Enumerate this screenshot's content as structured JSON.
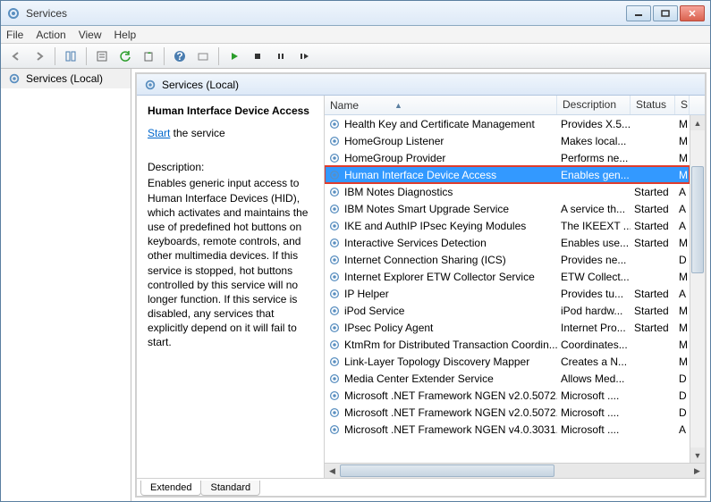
{
  "window": {
    "title": "Services"
  },
  "menu": {
    "file": "File",
    "action": "Action",
    "view": "View",
    "help": "Help"
  },
  "tree": {
    "root": "Services (Local)"
  },
  "header": {
    "label": "Services (Local)"
  },
  "detail": {
    "title": "Human Interface Device Access",
    "start_link": "Start",
    "start_suffix": " the service",
    "desc_heading": "Description:",
    "description": "Enables generic input access to Human Interface Devices (HID), which activates and maintains the use of predefined hot buttons on keyboards, remote controls, and other multimedia devices. If this service is stopped, hot buttons controlled by this service will no longer function. If this service is disabled, any services that explicitly depend on it will fail to start."
  },
  "columns": {
    "name": "Name",
    "description": "Description",
    "status": "Status",
    "startup": "S"
  },
  "services": [
    {
      "name": "Health Key and Certificate Management",
      "desc": "Provides X.5...",
      "status": "",
      "start": "M"
    },
    {
      "name": "HomeGroup Listener",
      "desc": "Makes local...",
      "status": "",
      "start": "M"
    },
    {
      "name": "HomeGroup Provider",
      "desc": "Performs ne...",
      "status": "",
      "start": "M"
    },
    {
      "name": "Human Interface Device Access",
      "desc": "Enables gen...",
      "status": "",
      "start": "M",
      "selected": true,
      "highlighted": true
    },
    {
      "name": "IBM Notes Diagnostics",
      "desc": "",
      "status": "Started",
      "start": "A"
    },
    {
      "name": "IBM Notes Smart Upgrade Service",
      "desc": "A service th...",
      "status": "Started",
      "start": "A"
    },
    {
      "name": "IKE and AuthIP IPsec Keying Modules",
      "desc": "The IKEEXT ...",
      "status": "Started",
      "start": "A"
    },
    {
      "name": "Interactive Services Detection",
      "desc": "Enables use...",
      "status": "Started",
      "start": "M"
    },
    {
      "name": "Internet Connection Sharing (ICS)",
      "desc": "Provides ne...",
      "status": "",
      "start": "D"
    },
    {
      "name": "Internet Explorer ETW Collector Service",
      "desc": "ETW Collect...",
      "status": "",
      "start": "M"
    },
    {
      "name": "IP Helper",
      "desc": "Provides tu...",
      "status": "Started",
      "start": "A"
    },
    {
      "name": "iPod Service",
      "desc": "iPod hardw...",
      "status": "Started",
      "start": "M"
    },
    {
      "name": "IPsec Policy Agent",
      "desc": "Internet Pro...",
      "status": "Started",
      "start": "M"
    },
    {
      "name": "KtmRm for Distributed Transaction Coordin...",
      "desc": "Coordinates...",
      "status": "",
      "start": "M"
    },
    {
      "name": "Link-Layer Topology Discovery Mapper",
      "desc": "Creates a N...",
      "status": "",
      "start": "M"
    },
    {
      "name": "Media Center Extender Service",
      "desc": "Allows Med...",
      "status": "",
      "start": "D"
    },
    {
      "name": "Microsoft .NET Framework NGEN v2.0.5072...",
      "desc": "Microsoft ....",
      "status": "",
      "start": "D"
    },
    {
      "name": "Microsoft .NET Framework NGEN v2.0.5072...",
      "desc": "Microsoft ....",
      "status": "",
      "start": "D"
    },
    {
      "name": "Microsoft .NET Framework NGEN v4.0.3031...",
      "desc": "Microsoft ....",
      "status": "",
      "start": "A"
    }
  ],
  "tabs": {
    "extended": "Extended",
    "standard": "Standard"
  }
}
